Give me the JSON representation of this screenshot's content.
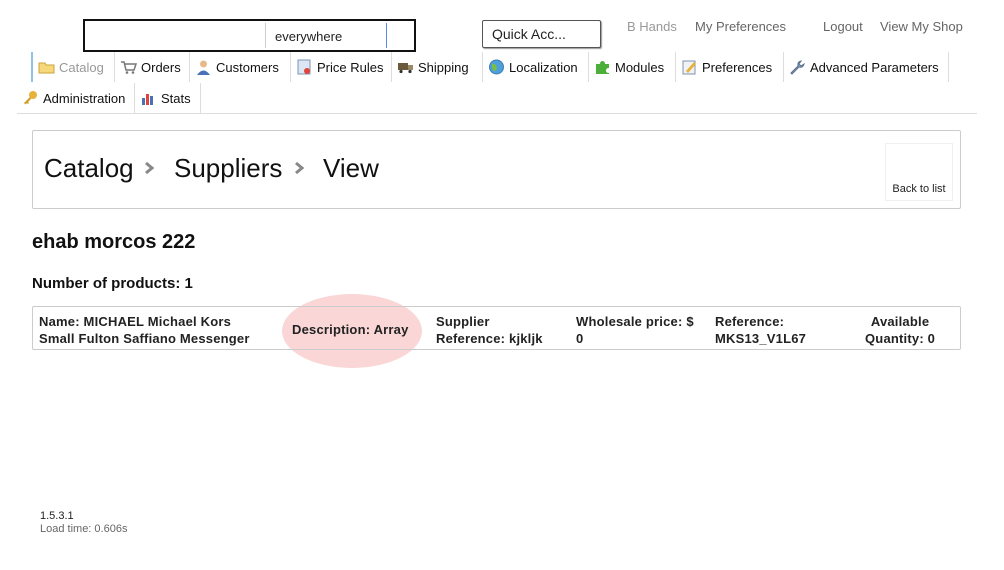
{
  "header": {
    "search": {
      "value": "",
      "scope": "everywhere"
    },
    "quick_access": "Quick Acc...",
    "user_name": "B Hands",
    "my_preferences": "My Preferences",
    "logout": "Logout",
    "view_shop": "View My Shop"
  },
  "tabs": [
    {
      "label": "Catalog",
      "icon": "folder-icon",
      "active": true
    },
    {
      "label": "Orders",
      "icon": "cart-icon"
    },
    {
      "label": "Customers",
      "icon": "customer-icon"
    },
    {
      "label": "Price Rules",
      "icon": "price-rules-icon"
    },
    {
      "label": "Shipping",
      "icon": "truck-icon"
    },
    {
      "label": "Localization",
      "icon": "globe-icon"
    },
    {
      "label": "Modules",
      "icon": "puzzle-icon"
    },
    {
      "label": "Preferences",
      "icon": "preferences-icon"
    },
    {
      "label": "Advanced Parameters",
      "icon": "wrench-icon"
    },
    {
      "label": "Administration",
      "icon": "key-icon"
    },
    {
      "label": "Stats",
      "icon": "bar-chart-icon"
    }
  ],
  "breadcrumb": {
    "items": [
      "Catalog",
      "Suppliers",
      "View"
    ]
  },
  "back_button": "Back to list",
  "supplier": {
    "name": "ehab morcos 222",
    "product_count_text": "Number of products: 1"
  },
  "product": {
    "name_line1": "Name: MICHAEL Michael Kors",
    "name_line2": "Small Fulton Saffiano Messenger",
    "description": "Description: Array",
    "supplier_ref_line1": "Supplier",
    "supplier_ref_line2": "Reference: kjkljk",
    "wholesale_line1": "Wholesale price: $",
    "wholesale_line2": "0",
    "reference_line1": "Reference:",
    "reference_line2": "MKS13_V1L67",
    "qty_line1": "Available",
    "qty_line2": "Quantity: 0"
  },
  "footer": {
    "version": "1.5.3.1",
    "load_time": "Load time: 0.606s"
  },
  "colors": {
    "highlight": "#f4a4a4",
    "active_tab_border": "#8ec3e8"
  }
}
